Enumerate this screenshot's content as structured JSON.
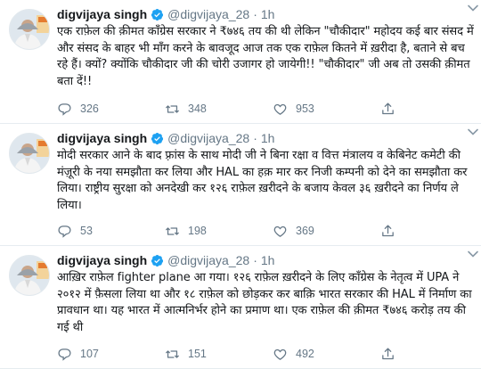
{
  "tweets": [
    {
      "name": "digvijaya singh",
      "handle": "@digvijaya_28",
      "separator": "·",
      "time": "1h",
      "text": "एक राफ़ेल की क़ीमत कॉंग्रेस सरकार ने ₹७४६ तय की थी लेकिन \"चौकीदार\" महोदय कई बार संसद में और संसद के बाहर भी माँग करने के बावजूद आज तक एक राफ़ेल कितने में ख़रीदा है, बताने से बच रहे हैं। क्यों? क्योंकि चौकीदार जी की चोरी उजागर हो जायेगी!! \"चौकीदार\" जी अब तो उसकी क़ीमत बता दें!!",
      "replies": "326",
      "retweets": "348",
      "likes": "953"
    },
    {
      "name": "digvijaya singh",
      "handle": "@digvijaya_28",
      "separator": "·",
      "time": "1h",
      "text": "मोदी सरकार आने के बाद फ़्रांस के साथ मोदी जी ने बिना रक्षा व वित्त मंत्रालय व केबिनेट कमेटी की मंज़ूरी के नया समझौता कर लिया और HAL का हक़ मार कर निजी कम्पनी को देने का समझौता कर लिया। राष्ट्रीय सुरक्षा को अनदेखी कर १२६ राफ़ेल ख़रीदने के बजाय केवल ३६ ख़रीदने का निर्णय ले लिया।",
      "replies": "53",
      "retweets": "198",
      "likes": "369"
    },
    {
      "name": "digvijaya singh",
      "handle": "@digvijaya_28",
      "separator": "·",
      "time": "1h",
      "text": "आख़िर राफ़ेल fighter plane आ गया। १२६ राफ़ेल ख़रीदने के लिए कॉंग्रेस के नेतृत्व में UPA ने २०१२ में फ़ैसला लिया था और १८ राफ़ेल को छोड़कर कर बाक़ि भारत सरकार की HAL में निर्माण का प्रावधान था। यह भारत में आत्मनिर्भर होने का प्रमाण था। एक राफ़ेल की क़ीमत ₹७४६ करोड़ तय की गई थी",
      "replies": "107",
      "retweets": "151",
      "likes": "492"
    }
  ],
  "icons": {
    "avatar": "profile-photo",
    "verified": "verified-badge-icon",
    "more": "chevron-down-icon",
    "reply": "reply-icon",
    "retweet": "retweet-icon",
    "like": "heart-icon",
    "share": "share-icon"
  },
  "colors": {
    "text": "#14171a",
    "muted": "#657786",
    "verified": "#1da1f2",
    "divider": "#e6ecf0"
  }
}
